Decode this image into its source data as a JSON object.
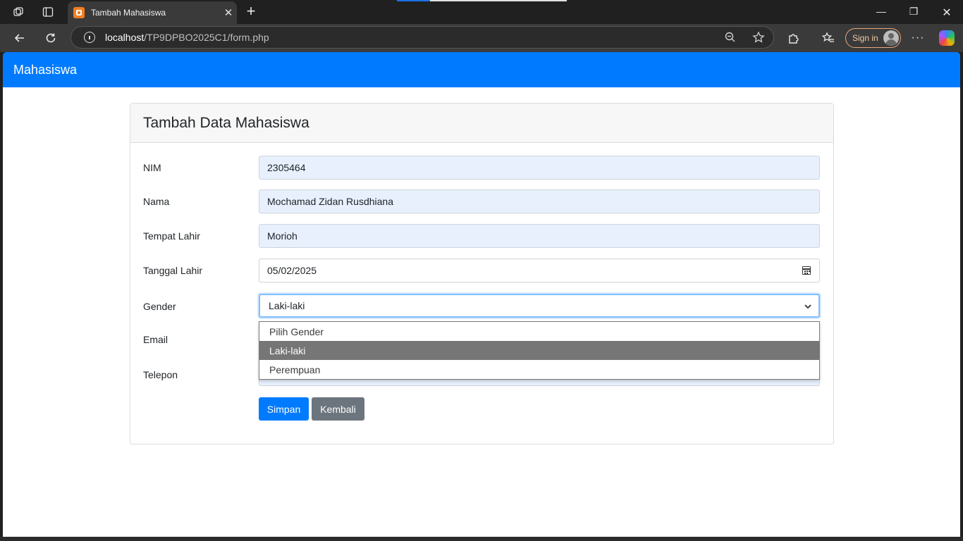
{
  "browser": {
    "tab_title": "Tambah Mahasiswa",
    "url_host": "localhost",
    "url_path": "/TP9DPBO2025C1/form.php",
    "sign_in_label": "Sign in",
    "accent": "#007bff"
  },
  "app": {
    "brand": "Mahasiswa"
  },
  "form": {
    "title": "Tambah Data Mahasiswa",
    "nim_label": "NIM",
    "nim_value": "2305464",
    "nama_label": "Nama",
    "nama_value": "Mochamad Zidan Rusdhiana",
    "tempat_label": "Tempat Lahir",
    "tempat_value": "Morioh",
    "tanggal_label": "Tanggal Lahir",
    "tanggal_value": "05/02/2025",
    "gender_label": "Gender",
    "gender_value": "Laki-laki",
    "gender_options": [
      "Pilih Gender",
      "Laki-laki",
      "Perempuan"
    ],
    "email_label": "Email",
    "telepon_label": "Telepon",
    "save_label": "Simpan",
    "back_label": "Kembali"
  }
}
